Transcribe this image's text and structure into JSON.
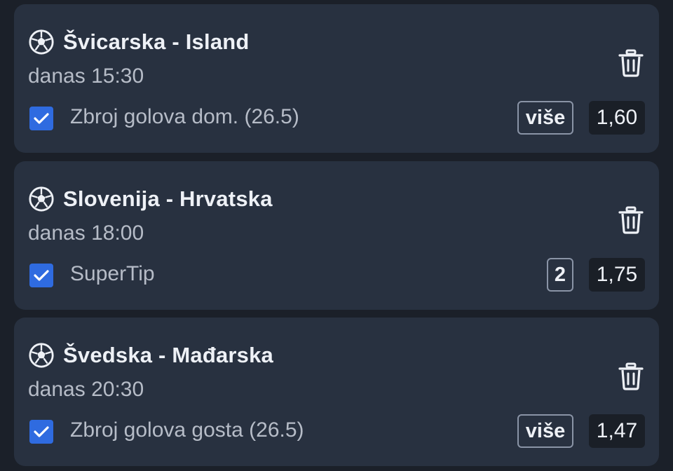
{
  "bets": [
    {
      "title": "Švicarska - Island",
      "time": "danas 15:30",
      "market": "Zbroj golova dom. (26.5)",
      "pick": "više",
      "odds": "1,60",
      "sport_icon": "soccer-ball-icon",
      "checked": true
    },
    {
      "title": "Slovenija - Hrvatska",
      "time": "danas 18:00",
      "market": "SuperTip",
      "pick": "2",
      "odds": "1,75",
      "sport_icon": "soccer-ball-icon",
      "checked": true
    },
    {
      "title": "Švedska - Mađarska",
      "time": "danas 20:30",
      "market": "Zbroj golova gosta (26.5)",
      "pick": "više",
      "odds": "1,47",
      "sport_icon": "soccer-ball-icon",
      "checked": true
    }
  ],
  "colors": {
    "background": "#1b2029",
    "card": "#283140",
    "checkbox": "#2f6be0",
    "odds_bg": "#1a1f27",
    "text_primary": "#eef1f6",
    "text_secondary": "#b6bcc7"
  },
  "icons": {
    "delete": "trash-icon",
    "check": "checkmark-icon"
  }
}
